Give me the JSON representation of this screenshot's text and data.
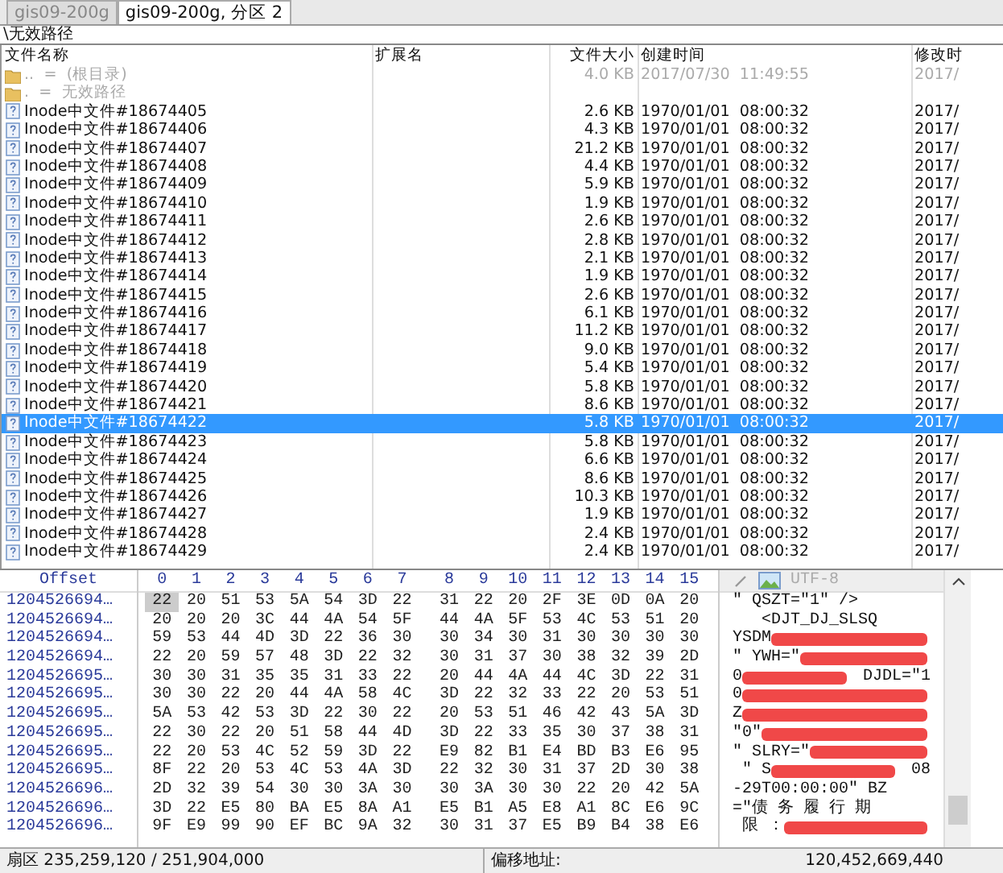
{
  "tabs": [
    {
      "label": "gis09-200g",
      "selected": false
    },
    {
      "label": "gis09-200g, 分区 2",
      "selected": true
    }
  ],
  "path": "\\无效路径",
  "file_list": {
    "columns": [
      "文件名称",
      "扩展名",
      "文件大小",
      "创建时间",
      "修改时"
    ],
    "rows": [
      {
        "kind": "folder",
        "name": "..  =  (根目录)",
        "size": "4.0 KB",
        "created": "2017/07/30  11:49:55",
        "modified": "2017/",
        "dimmed": true,
        "selected": false
      },
      {
        "kind": "folder",
        "name": ".  =  无效路径",
        "dimmed": true,
        "selected": false
      },
      {
        "kind": "file",
        "name": "Inode中文件#18674405",
        "size": "2.6 KB",
        "created": "1970/01/01  08:00:32",
        "modified": "2017/",
        "dimmed": false,
        "selected": false
      },
      {
        "kind": "file",
        "name": "Inode中文件#18674406",
        "size": "4.3 KB",
        "created": "1970/01/01  08:00:32",
        "modified": "2017/",
        "dimmed": false,
        "selected": false
      },
      {
        "kind": "file",
        "name": "Inode中文件#18674407",
        "size": "21.2 KB",
        "created": "1970/01/01  08:00:32",
        "modified": "2017/",
        "dimmed": false,
        "selected": false
      },
      {
        "kind": "file",
        "name": "Inode中文件#18674408",
        "size": "4.4 KB",
        "created": "1970/01/01  08:00:32",
        "modified": "2017/",
        "dimmed": false,
        "selected": false
      },
      {
        "kind": "file",
        "name": "Inode中文件#18674409",
        "size": "5.9 KB",
        "created": "1970/01/01  08:00:32",
        "modified": "2017/",
        "dimmed": false,
        "selected": false
      },
      {
        "kind": "file",
        "name": "Inode中文件#18674410",
        "size": "1.9 KB",
        "created": "1970/01/01  08:00:32",
        "modified": "2017/",
        "dimmed": false,
        "selected": false
      },
      {
        "kind": "file",
        "name": "Inode中文件#18674411",
        "size": "2.6 KB",
        "created": "1970/01/01  08:00:32",
        "modified": "2017/",
        "dimmed": false,
        "selected": false
      },
      {
        "kind": "file",
        "name": "Inode中文件#18674412",
        "size": "2.8 KB",
        "created": "1970/01/01  08:00:32",
        "modified": "2017/",
        "dimmed": false,
        "selected": false
      },
      {
        "kind": "file",
        "name": "Inode中文件#18674413",
        "size": "2.1 KB",
        "created": "1970/01/01  08:00:32",
        "modified": "2017/",
        "dimmed": false,
        "selected": false
      },
      {
        "kind": "file",
        "name": "Inode中文件#18674414",
        "size": "1.9 KB",
        "created": "1970/01/01  08:00:32",
        "modified": "2017/",
        "dimmed": false,
        "selected": false
      },
      {
        "kind": "file",
        "name": "Inode中文件#18674415",
        "size": "2.6 KB",
        "created": "1970/01/01  08:00:32",
        "modified": "2017/",
        "dimmed": false,
        "selected": false
      },
      {
        "kind": "file",
        "name": "Inode中文件#18674416",
        "size": "6.1 KB",
        "created": "1970/01/01  08:00:32",
        "modified": "2017/",
        "dimmed": false,
        "selected": false
      },
      {
        "kind": "file",
        "name": "Inode中文件#18674417",
        "size": "11.2 KB",
        "created": "1970/01/01  08:00:32",
        "modified": "2017/",
        "dimmed": false,
        "selected": false
      },
      {
        "kind": "file",
        "name": "Inode中文件#18674418",
        "size": "9.0 KB",
        "created": "1970/01/01  08:00:32",
        "modified": "2017/",
        "dimmed": false,
        "selected": false
      },
      {
        "kind": "file",
        "name": "Inode中文件#18674419",
        "size": "5.4 KB",
        "created": "1970/01/01  08:00:32",
        "modified": "2017/",
        "dimmed": false,
        "selected": false
      },
      {
        "kind": "file",
        "name": "Inode中文件#18674420",
        "size": "5.8 KB",
        "created": "1970/01/01  08:00:32",
        "modified": "2017/",
        "dimmed": false,
        "selected": false
      },
      {
        "kind": "file",
        "name": "Inode中文件#18674421",
        "size": "8.6 KB",
        "created": "1970/01/01  08:00:32",
        "modified": "2017/",
        "dimmed": false,
        "selected": false
      },
      {
        "kind": "file",
        "name": "Inode中文件#18674422",
        "size": "5.8 KB",
        "created": "1970/01/01  08:00:32",
        "modified": "2017/",
        "dimmed": false,
        "selected": true
      },
      {
        "kind": "file",
        "name": "Inode中文件#18674423",
        "size": "5.8 KB",
        "created": "1970/01/01  08:00:32",
        "modified": "2017/",
        "dimmed": false,
        "selected": false
      },
      {
        "kind": "file",
        "name": "Inode中文件#18674424",
        "size": "6.6 KB",
        "created": "1970/01/01  08:00:32",
        "modified": "2017/",
        "dimmed": false,
        "selected": false
      },
      {
        "kind": "file",
        "name": "Inode中文件#18674425",
        "size": "8.6 KB",
        "created": "1970/01/01  08:00:32",
        "modified": "2017/",
        "dimmed": false,
        "selected": false
      },
      {
        "kind": "file",
        "name": "Inode中文件#18674426",
        "size": "10.3 KB",
        "created": "1970/01/01  08:00:32",
        "modified": "2017/",
        "dimmed": false,
        "selected": false
      },
      {
        "kind": "file",
        "name": "Inode中文件#18674427",
        "size": "1.9 KB",
        "created": "1970/01/01  08:00:32",
        "modified": "2017/",
        "dimmed": false,
        "selected": false
      },
      {
        "kind": "file",
        "name": "Inode中文件#18674428",
        "size": "2.4 KB",
        "created": "1970/01/01  08:00:32",
        "modified": "2017/",
        "dimmed": false,
        "selected": false
      },
      {
        "kind": "file",
        "name": "Inode中文件#18674429",
        "size": "2.4 KB",
        "created": "1970/01/01  08:00:32",
        "modified": "2017/",
        "dimmed": false,
        "selected": false
      }
    ]
  },
  "hex_view": {
    "columns": [
      "Offset",
      "0",
      "1",
      "2",
      "3",
      "4",
      "5",
      "6",
      "7",
      "8",
      "9",
      "10",
      "11",
      "12",
      "13",
      "14",
      "15"
    ],
    "encoding": "UTF-8",
    "rows": [
      {
        "offset": "1204526694…",
        "bytes": "22 20 51 53 5A 54 3D 22 31 22 20 2F 3E 0D 0A 20",
        "cursor": true
      },
      {
        "offset": "1204526694…",
        "bytes": "20 20 20 3C 44 4A 54 5F 44 4A 5F 53 4C 53 51 20",
        "cursor": false
      },
      {
        "offset": "1204526694…",
        "bytes": "59 53 44 4D 3D 22 36 30 30 34 30 31 30 30 30 30",
        "cursor": false
      },
      {
        "offset": "1204526694…",
        "bytes": "22 20 59 57 48 3D 22 32 30 31 37 30 38 32 39 2D",
        "cursor": false
      },
      {
        "offset": "1204526695…",
        "bytes": "30 30 31 35 35 31 33 22 20 44 4A 44 4C 3D 22 31",
        "cursor": false
      },
      {
        "offset": "1204526695…",
        "bytes": "30 30 22 20 44 4A 58 4C 3D 22 32 33 22 20 53 51",
        "cursor": false
      },
      {
        "offset": "1204526695…",
        "bytes": "5A 53 42 53 3D 22 30 22 20 53 51 46 42 43 5A 3D",
        "cursor": false
      },
      {
        "offset": "1204526695…",
        "bytes": "22 30 22 20 51 58 44 4D 3D 22 33 35 30 37 38 31",
        "cursor": false
      },
      {
        "offset": "1204526695…",
        "bytes": "22 20 53 4C 52 59 3D 22 E9 82 B1 E4 BD B3 E6 95",
        "cursor": false
      },
      {
        "offset": "1204526695…",
        "bytes": "8F 22 20 53 4C 53 4A 3D 22 32 30 31 37 2D 30 38",
        "cursor": false
      },
      {
        "offset": "1204526696…",
        "bytes": "2D 32 39 54 30 30 3A 30 30 3A 30 30 22 20 42 5A",
        "cursor": false
      },
      {
        "offset": "1204526696…",
        "bytes": "3D 22 E5 80 BA E5 8A A1 E5 B1 A5 E8 A1 8C E6 9C",
        "cursor": false
      },
      {
        "offset": "1204526696…",
        "bytes": "9F E9 99 90 EF BC 9A 32 30 31 37 E5 B9 B4 38 E6",
        "cursor": false
      }
    ],
    "text_lines": [
      {
        "text": "\" QSZT=\"1\" />",
        "redacted": false
      },
      {
        "text": "   <DJT_DJ_SLSQ",
        "redacted": false
      },
      {
        "text": "YSDM",
        "redacted": true
      },
      {
        "text": "\" YWH=\"",
        "redacted": true
      },
      {
        "text": "0",
        "redacted": true,
        "tail": "DJDL=\"1"
      },
      {
        "text": "0",
        "redacted": true
      },
      {
        "text": "Z",
        "redacted": true
      },
      {
        "text": "\"0\"",
        "redacted": true
      },
      {
        "text": "\" SLRY=\"",
        "redacted": true
      },
      {
        "text": " \" S",
        "redacted": true,
        "tail": "08"
      },
      {
        "text": "-29T00:00:00\" BZ",
        "redacted": false
      },
      {
        "text": "=\"债 务 履 行 期",
        "redacted": false
      },
      {
        "text": " 限 ：",
        "redacted": true
      }
    ]
  },
  "status_bar": {
    "sector": "扇区 235,259,120 / 251,904,000",
    "offset_label": "偏移地址:",
    "offset_value": "120,452,669,440"
  }
}
